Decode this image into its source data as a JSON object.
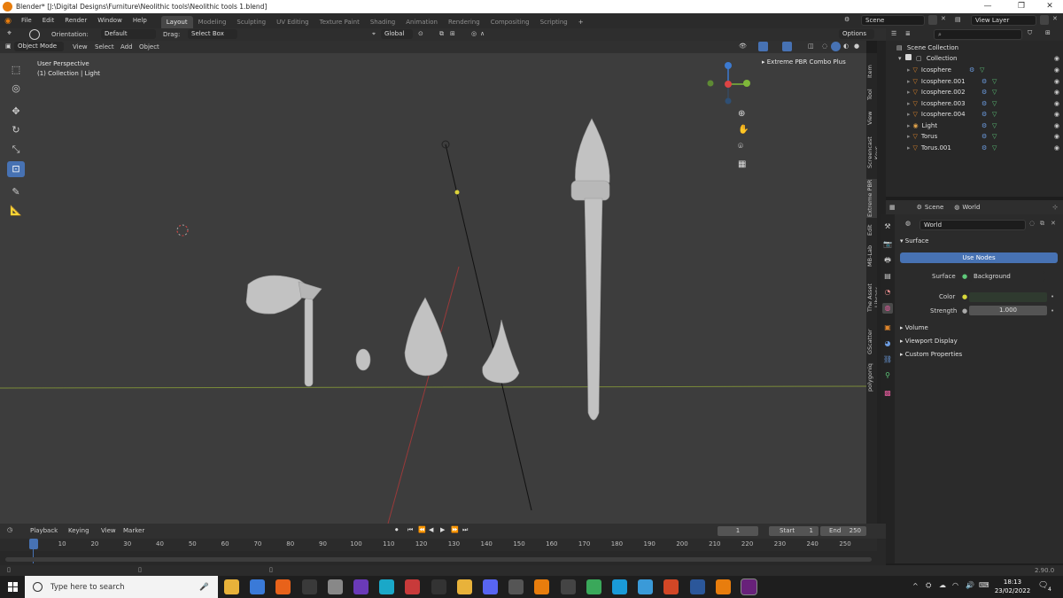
{
  "window": {
    "title": "Blender* [J:\\Digital Designs\\Furniture\\Neolithic tools\\Neolithic tools 1.blend]"
  },
  "topbar": {
    "menu": [
      "File",
      "Edit",
      "Render",
      "Window",
      "Help"
    ],
    "workspaces": [
      "Layout",
      "Modeling",
      "Sculpting",
      "UV Editing",
      "Texture Paint",
      "Shading",
      "Animation",
      "Rendering",
      "Compositing",
      "Scripting"
    ],
    "active_workspace": "Layout",
    "scene_label": "Scene",
    "view_layer_label": "View Layer"
  },
  "tool_header": {
    "orientation_label": "Orientation:",
    "orientation_value": "Default",
    "drag_label": "Drag:",
    "drag_value": "Select Box",
    "transform_orientation": "Global",
    "options_label": "Options"
  },
  "viewport_header": {
    "mode": "Object Mode",
    "menus": [
      "View",
      "Select",
      "Add",
      "Object"
    ]
  },
  "viewport": {
    "perspective_label": "User Perspective",
    "collection_label": "(1) Collection | Light",
    "addon_panel": "Extreme PBR Combo Plus",
    "gizmo_axes": [
      "X",
      "Y",
      "Z"
    ]
  },
  "sidebar_tabs": [
    "Item",
    "Tool",
    "View",
    "Screencast Keys",
    "Extreme PBR",
    "Edit",
    "MB-Lab",
    "The Asset Library",
    "GScatter",
    "polygoniq"
  ],
  "outliner": {
    "root": "Scene Collection",
    "collection": "Collection",
    "items": [
      {
        "name": "Icosphere"
      },
      {
        "name": "Icosphere.001"
      },
      {
        "name": "Icosphere.002"
      },
      {
        "name": "Icosphere.003"
      },
      {
        "name": "Icosphere.004"
      },
      {
        "name": "Light"
      },
      {
        "name": "Torus"
      },
      {
        "name": "Torus.001"
      }
    ]
  },
  "properties": {
    "breadcrumb_scene": "Scene",
    "breadcrumb_world": "World",
    "world_name": "World",
    "surface_section": "Surface",
    "use_nodes_button": "Use Nodes",
    "surface_label": "Surface",
    "surface_value": "Background",
    "color_label": "Color",
    "strength_label": "Strength",
    "strength_value": "1.000",
    "sections": [
      "Volume",
      "Viewport Display",
      "Custom Properties"
    ]
  },
  "timeline": {
    "menus": [
      "Playback",
      "Keying",
      "View",
      "Marker"
    ],
    "current_frame": "1",
    "start_label": "Start",
    "start_value": "1",
    "end_label": "End",
    "end_value": "250",
    "ticks": [
      "1",
      "10",
      "20",
      "30",
      "40",
      "50",
      "60",
      "70",
      "80",
      "90",
      "100",
      "110",
      "120",
      "130",
      "140",
      "150",
      "160",
      "170",
      "180",
      "190",
      "200",
      "210",
      "220",
      "230",
      "240",
      "250"
    ]
  },
  "statusbar": {
    "version": "2.90.0"
  },
  "taskbar": {
    "search_placeholder": "Type here to search",
    "time": "18:13",
    "date": "23/02/2022",
    "notification_count": "4"
  },
  "colors": {
    "accent": "#4772b3",
    "viewport_bg": "#3d3d3d",
    "orange_object": "#e0862b",
    "green_data": "#5ec97a"
  }
}
